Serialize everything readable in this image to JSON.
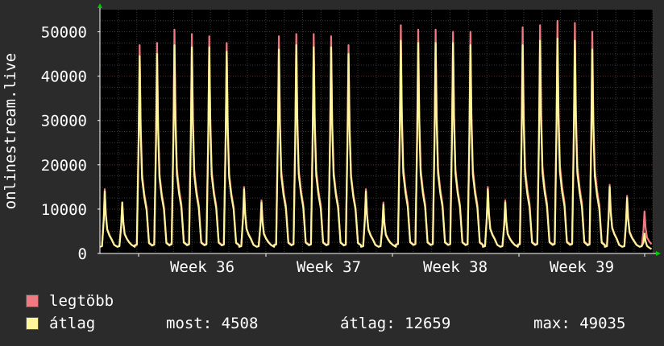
{
  "chart_data": {
    "type": "area",
    "ylabel": "onlinestream.live",
    "ylim": [
      0,
      55000
    ],
    "yticks": [
      0,
      10000,
      20000,
      30000,
      40000,
      50000
    ],
    "xticks": [
      "Week 36",
      "Week 37",
      "Week 38",
      "Week 39"
    ],
    "grid": true,
    "legend_placement": "bottom-left",
    "colors": {
      "background": "#2b2b2b",
      "plot_bg": "#000000",
      "grid": "#3a3a3a",
      "max": "#f07a80",
      "avg": "#fff59a",
      "axis": "#ffffff",
      "arrow": "#00cc00"
    },
    "days": 30,
    "series": [
      {
        "name": "legtöbb",
        "daily_peaks": [
          14500,
          11500,
          47000,
          47500,
          50500,
          49500,
          49000,
          47500,
          15000,
          12000,
          49000,
          49500,
          49500,
          49000,
          47000,
          14500,
          11500,
          51500,
          50500,
          50500,
          50000,
          50000,
          15000,
          12000,
          51000,
          51500,
          52500,
          52000,
          50000,
          15500,
          13000,
          9500
        ]
      },
      {
        "name": "átlag",
        "daily_peaks": [
          14000,
          11500,
          44500,
          45000,
          47000,
          46500,
          46500,
          45500,
          14500,
          11500,
          46000,
          47000,
          46500,
          46500,
          45000,
          14000,
          11000,
          48000,
          47500,
          47500,
          47500,
          47000,
          14500,
          11500,
          47000,
          48000,
          48500,
          48000,
          46000,
          15000,
          12500,
          4500
        ]
      }
    ]
  },
  "legend": {
    "max_label": "legtöbb",
    "avg_label": "átlag"
  },
  "stats": {
    "most": "most: 4508",
    "atlag": "átlag: 12659",
    "max": "max: 49035"
  }
}
